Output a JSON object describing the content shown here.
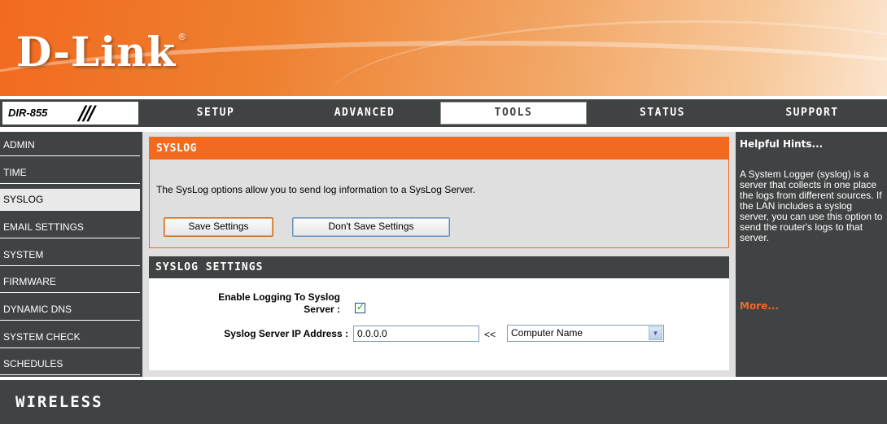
{
  "header": {
    "logo": "D-Link",
    "logo_mark": "®"
  },
  "model": "DIR-855",
  "nav": {
    "tabs": [
      "SETUP",
      "ADVANCED",
      "TOOLS",
      "STATUS",
      "SUPPORT"
    ],
    "active": "TOOLS"
  },
  "sidebar": {
    "items": [
      "ADMIN",
      "TIME",
      "SYSLOG",
      "EMAIL SETTINGS",
      "SYSTEM",
      "FIRMWARE",
      "DYNAMIC DNS",
      "SYSTEM CHECK",
      "SCHEDULES"
    ],
    "active": "SYSLOG"
  },
  "syslog_section": {
    "title": "SYSLOG",
    "description": "The SysLog options allow you to send log information to a SysLog Server.",
    "save_label": "Save Settings",
    "dont_save_label": "Don't Save Settings"
  },
  "settings_section": {
    "title": "SYSLOG SETTINGS",
    "enable_label_line1": "Enable Logging To Syslog",
    "enable_label_line2": "Server :",
    "enable_checked": true,
    "ip_label": "Syslog Server IP Address :",
    "ip_value": "0.0.0.0",
    "arrows": "<<",
    "computer_select_value": "Computer Name"
  },
  "hints": {
    "title": "Helpful Hints...",
    "text": "A System Logger (syslog) is a server that collects in one place the logs from different sources. If the LAN includes a syslog server, you can use this option to send the router's logs to that server.",
    "more": "More..."
  },
  "footer": {
    "label": "WIRELESS"
  },
  "colors": {
    "orange": "#f26a1f",
    "dark": "#404343",
    "panel": "#dfdfdf"
  }
}
